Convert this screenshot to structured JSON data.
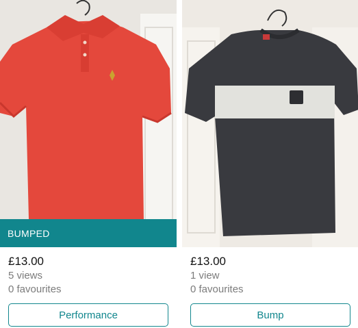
{
  "listings": [
    {
      "badge": "BUMPED",
      "price": "£13.00",
      "views": "5 views",
      "favourites": "0 favourites",
      "action_label": "Performance"
    },
    {
      "price": "£13.00",
      "views": "1 view",
      "favourites": "0 favourites",
      "action_label": "Bump"
    }
  ],
  "colors": {
    "accent": "#11868d",
    "secondary_text": "#7b7b7b",
    "shirt_red": "#e4483c",
    "shirt_dark": "#393a3f",
    "stripe": "#e2e2dd"
  }
}
